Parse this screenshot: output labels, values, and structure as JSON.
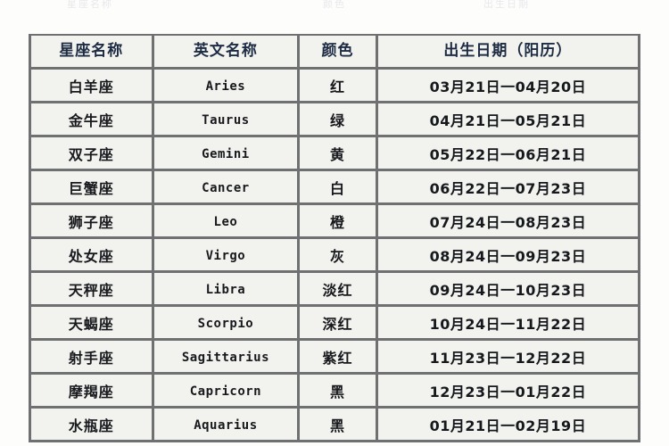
{
  "ghost_row": {
    "visible_fragments": [
      "星座名称",
      "颜色",
      "出生日期"
    ]
  },
  "table": {
    "headers": [
      {
        "key": "name",
        "label": "星座名称"
      },
      {
        "key": "en",
        "label": "英文名称"
      },
      {
        "key": "color",
        "label": "颜色"
      },
      {
        "key": "date",
        "label": "出生日期（阳历）"
      }
    ],
    "rows": [
      {
        "name": "白羊座",
        "en": "Aries",
        "color": "红",
        "date": "03月21日一04月20日"
      },
      {
        "name": "金牛座",
        "en": "Taurus",
        "color": "绿",
        "date": "04月21日一05月21日"
      },
      {
        "name": "双子座",
        "en": "Gemini",
        "color": "黄",
        "date": "05月22日一06月21日"
      },
      {
        "name": "巨蟹座",
        "en": "Cancer",
        "color": "白",
        "date": "06月22日一07月23日"
      },
      {
        "name": "狮子座",
        "en": "Leo",
        "color": "橙",
        "date": "07月24日一08月23日"
      },
      {
        "name": "处女座",
        "en": "Virgo",
        "color": "灰",
        "date": "08月24日一09月23日"
      },
      {
        "name": "天秤座",
        "en": "Libra",
        "color": "淡红",
        "date": "09月24日一10月23日"
      },
      {
        "name": "天蝎座",
        "en": "Scorpio",
        "color": "深红",
        "date": "10月24日一11月22日"
      },
      {
        "name": "射手座",
        "en": "Sagittarius",
        "color": "紫红",
        "date": "11月23日一12月22日"
      },
      {
        "name": "摩羯座",
        "en": "Capricorn",
        "color": "黑",
        "date": "12月23日一01月22日"
      },
      {
        "name": "水瓶座",
        "en": "Aquarius",
        "color": "黑",
        "date": "01月21日一02月19日"
      }
    ]
  },
  "colors": {
    "header_fill": "#9ecdf0",
    "header_text": "#1d2c44",
    "cell_fill": "#f2f2ee",
    "grid_line": "#6e7072",
    "page_background": "#fdfdfc"
  }
}
